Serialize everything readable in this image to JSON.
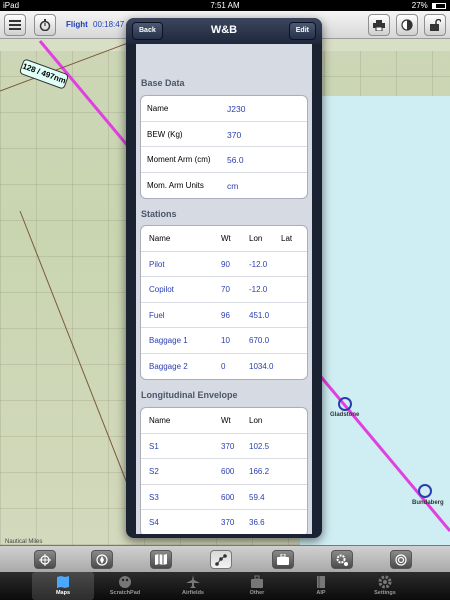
{
  "status_bar": {
    "carrier": "iPad",
    "time": "7:51 AM",
    "battery": "27%"
  },
  "map": {
    "flight_label": "Flight",
    "flight_time": "00:18:47",
    "distance_tag": "128 / 497nm",
    "places": {
      "gladstone": "Gladstone",
      "bundaberg": "Bundaberg"
    },
    "scale_label": "Nautical Miles"
  },
  "popover": {
    "title": "W&B",
    "back_label": "Back",
    "edit_label": "Edit",
    "base_data": {
      "heading": "Base Data",
      "rows": [
        {
          "label": "Name",
          "value": "J230"
        },
        {
          "label": "BEW (Kg)",
          "value": "370"
        },
        {
          "label": "Moment Arm (cm)",
          "value": "56.0"
        },
        {
          "label": "Mom. Arm Units",
          "value": "cm"
        }
      ]
    },
    "stations": {
      "heading": "Stations",
      "columns": [
        "Name",
        "Wt",
        "Lon",
        "Lat"
      ],
      "rows": [
        {
          "name": "Pilot",
          "wt": "90",
          "lon": "-12.0",
          "lat": ""
        },
        {
          "name": "Copilot",
          "wt": "70",
          "lon": "-12.0",
          "lat": ""
        },
        {
          "name": "Fuel",
          "wt": "96",
          "lon": "451.0",
          "lat": ""
        },
        {
          "name": "Baggage 1",
          "wt": "10",
          "lon": "670.0",
          "lat": ""
        },
        {
          "name": "Baggage 2",
          "wt": "0",
          "lon": "1034.0",
          "lat": ""
        }
      ]
    },
    "envelope": {
      "heading": "Longitudinal Envelope",
      "columns": [
        "Name",
        "Wt",
        "Lon"
      ],
      "rows": [
        {
          "name": "S1",
          "wt": "370",
          "lon": "102.5"
        },
        {
          "name": "S2",
          "wt": "600",
          "lon": "166.2"
        },
        {
          "name": "S3",
          "wt": "600",
          "lon": "59.4"
        },
        {
          "name": "S4",
          "wt": "370",
          "lon": "36.6"
        }
      ]
    }
  },
  "tabbar": {
    "tabs": [
      {
        "label": "Maps",
        "icon": "map-icon"
      },
      {
        "label": "ScratchPad",
        "icon": "palette-icon"
      },
      {
        "label": "Airfields",
        "icon": "airplane-icon"
      },
      {
        "label": "Other",
        "icon": "briefcase-icon"
      },
      {
        "label": "AIP",
        "icon": "book-icon"
      },
      {
        "label": "Settings",
        "icon": "gear-icon"
      }
    ],
    "active": "Maps"
  },
  "colors": {
    "route": "#e040e0",
    "accent_blue": "#2a3eb1",
    "popover_frame": "#1b2333"
  }
}
